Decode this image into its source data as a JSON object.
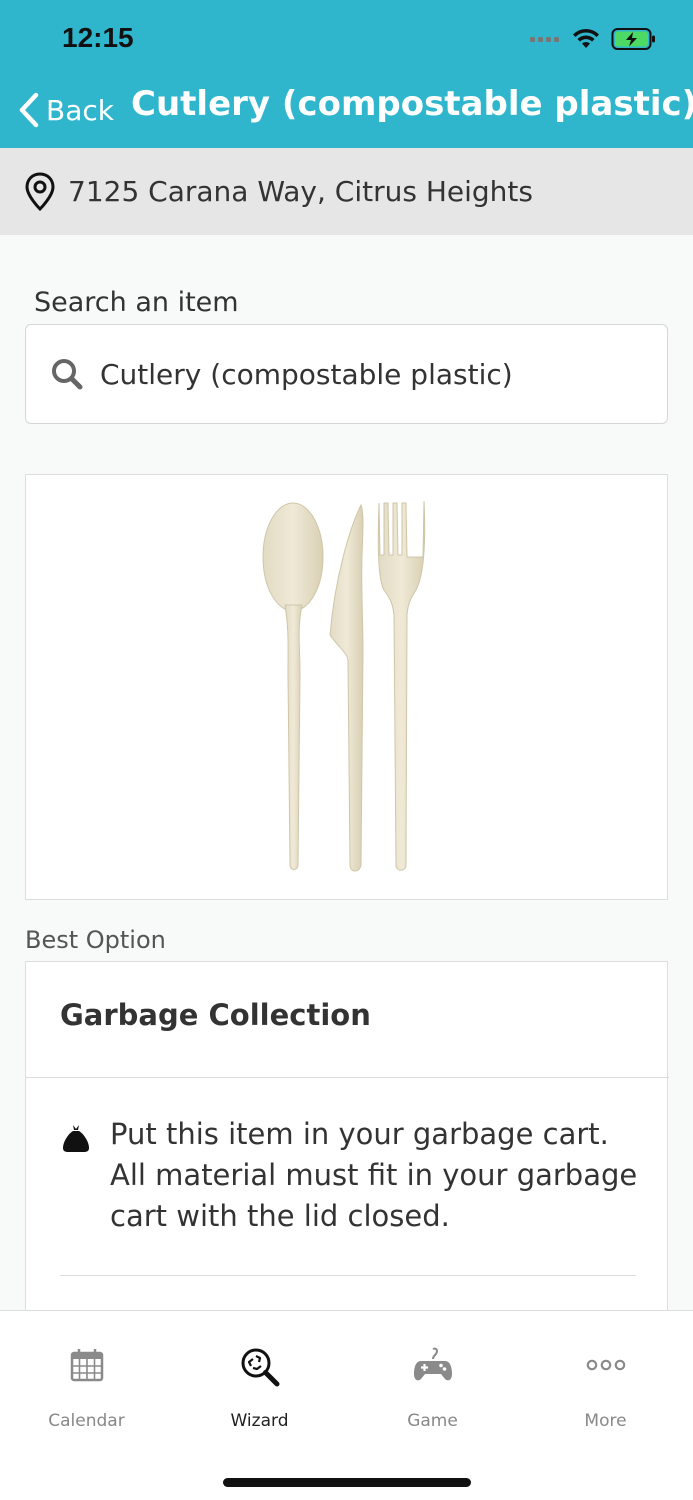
{
  "status": {
    "time": "12:15"
  },
  "header": {
    "back_label": "Back",
    "title": "Cutlery (compostable plastic)"
  },
  "location": {
    "address": "7125 Carana Way, Citrus Heights"
  },
  "search": {
    "label": "Search an item",
    "value": "Cutlery (compostable plastic)"
  },
  "best_option": {
    "label": "Best Option",
    "title": "Garbage Collection",
    "description": "Put this item in your garbage cart. All material must fit in your garbage cart with the lid closed."
  },
  "tabs": [
    {
      "label": "Calendar",
      "icon": "calendar-icon",
      "active": false
    },
    {
      "label": "Wizard",
      "icon": "wizard-recycle-search-icon",
      "active": true
    },
    {
      "label": "Game",
      "icon": "gamepad-icon",
      "active": false
    },
    {
      "label": "More",
      "icon": "more-dots-icon",
      "active": false
    }
  ],
  "colors": {
    "header": "#2fb6cd",
    "location_bar": "#e6e6e6",
    "background": "#f8f9f9",
    "battery": "#4cd964"
  }
}
